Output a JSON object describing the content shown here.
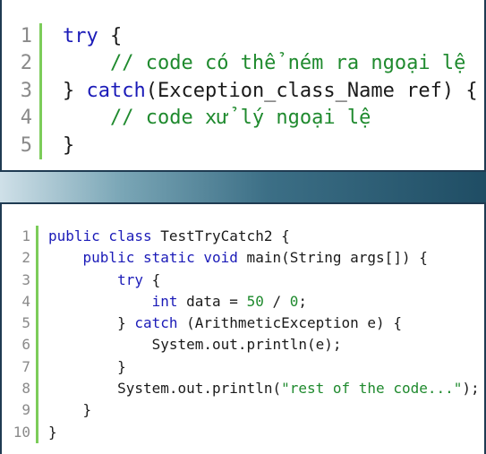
{
  "top_snippet": {
    "line_numbers": [
      "1",
      "2",
      "3",
      "4",
      "5"
    ],
    "lines": [
      [
        {
          "t": "try",
          "c": "kw"
        },
        {
          "t": " {",
          "c": ""
        }
      ],
      [
        {
          "t": "    ",
          "c": ""
        },
        {
          "t": "// code có thể ném ra ngoại lệ",
          "c": "cm"
        }
      ],
      [
        {
          "t": "} ",
          "c": ""
        },
        {
          "t": "catch",
          "c": "kw"
        },
        {
          "t": "(Exception_class_Name ref) {",
          "c": ""
        }
      ],
      [
        {
          "t": "    ",
          "c": ""
        },
        {
          "t": "// code xử lý ngoại lệ",
          "c": "cm"
        }
      ],
      [
        {
          "t": "}",
          "c": ""
        }
      ]
    ]
  },
  "bottom_snippet": {
    "line_numbers": [
      "1",
      "2",
      "3",
      "4",
      "5",
      "6",
      "7",
      "8",
      "9",
      "10"
    ],
    "lines": [
      [
        {
          "t": "public class",
          "c": "kw"
        },
        {
          "t": " TestTryCatch2 {",
          "c": ""
        }
      ],
      [
        {
          "t": "    ",
          "c": ""
        },
        {
          "t": "public static void",
          "c": "kw"
        },
        {
          "t": " main(String args[]) {",
          "c": ""
        }
      ],
      [
        {
          "t": "        ",
          "c": ""
        },
        {
          "t": "try",
          "c": "kw"
        },
        {
          "t": " {",
          "c": ""
        }
      ],
      [
        {
          "t": "            ",
          "c": ""
        },
        {
          "t": "int",
          "c": "kw"
        },
        {
          "t": " data = ",
          "c": ""
        },
        {
          "t": "50",
          "c": "num"
        },
        {
          "t": " / ",
          "c": ""
        },
        {
          "t": "0",
          "c": "num"
        },
        {
          "t": ";",
          "c": ""
        }
      ],
      [
        {
          "t": "        } ",
          "c": ""
        },
        {
          "t": "catch",
          "c": "kw"
        },
        {
          "t": " (ArithmeticException e) {",
          "c": ""
        }
      ],
      [
        {
          "t": "            System.out.println(e);",
          "c": ""
        }
      ],
      [
        {
          "t": "        }",
          "c": ""
        }
      ],
      [
        {
          "t": "        System.out.println(",
          "c": ""
        },
        {
          "t": "\"rest of the code...\"",
          "c": "str"
        },
        {
          "t": ");",
          "c": ""
        }
      ],
      [
        {
          "t": "    }",
          "c": ""
        }
      ],
      [
        {
          "t": "}",
          "c": ""
        }
      ]
    ]
  }
}
